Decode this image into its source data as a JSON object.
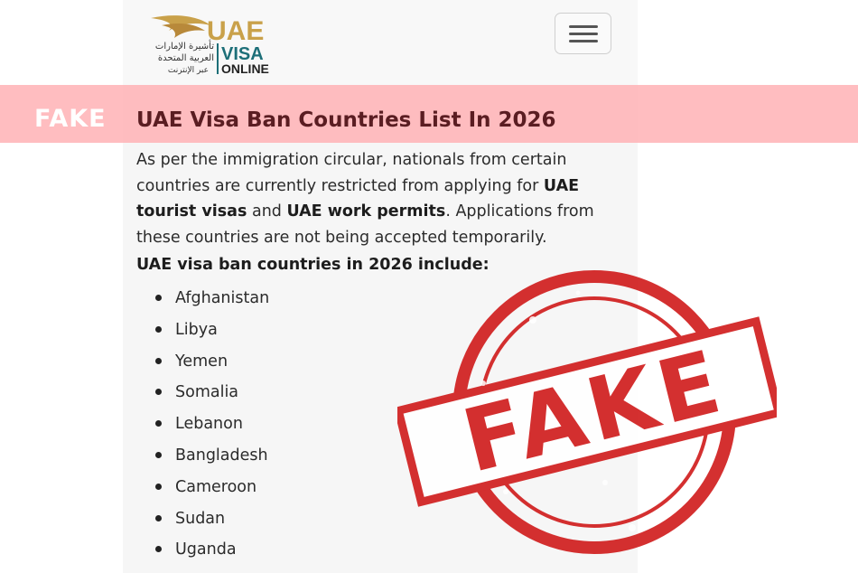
{
  "header": {
    "logo": {
      "brand_top": "UAE",
      "brand_mid": "VISA",
      "brand_bottom": "ONLINE",
      "arabic_line1": "تأشيرة الإمارات",
      "arabic_line2": "العربية المتحدة",
      "arabic_line3": "عبر الإنترنت",
      "colors": {
        "gold": "#c9a14a",
        "teal": "#1d6f78",
        "dark": "#222222"
      }
    },
    "menu_icon": "hamburger-menu-icon"
  },
  "banner": {
    "label": "FAKE",
    "color": "#ffb0b4"
  },
  "article": {
    "title": "UAE Visa Ban Countries List In 2026",
    "intro": {
      "part1": "As per the immigration circular, nationals from certain countries are currently restricted from applying for ",
      "bold1": "UAE tourist visas",
      "part2": " and ",
      "bold2": "UAE work permits",
      "part3": ". Applications from these countries are not being accepted temporarily."
    },
    "list_heading": "UAE visa ban countries in 2026 include:",
    "countries": [
      "Afghanistan",
      "Libya",
      "Yemen",
      "Somalia",
      "Lebanon",
      "Bangladesh",
      "Cameroon",
      "Sudan",
      "Uganda"
    ]
  },
  "stamp": {
    "label": "FAKE",
    "color": "#d11f1f"
  }
}
